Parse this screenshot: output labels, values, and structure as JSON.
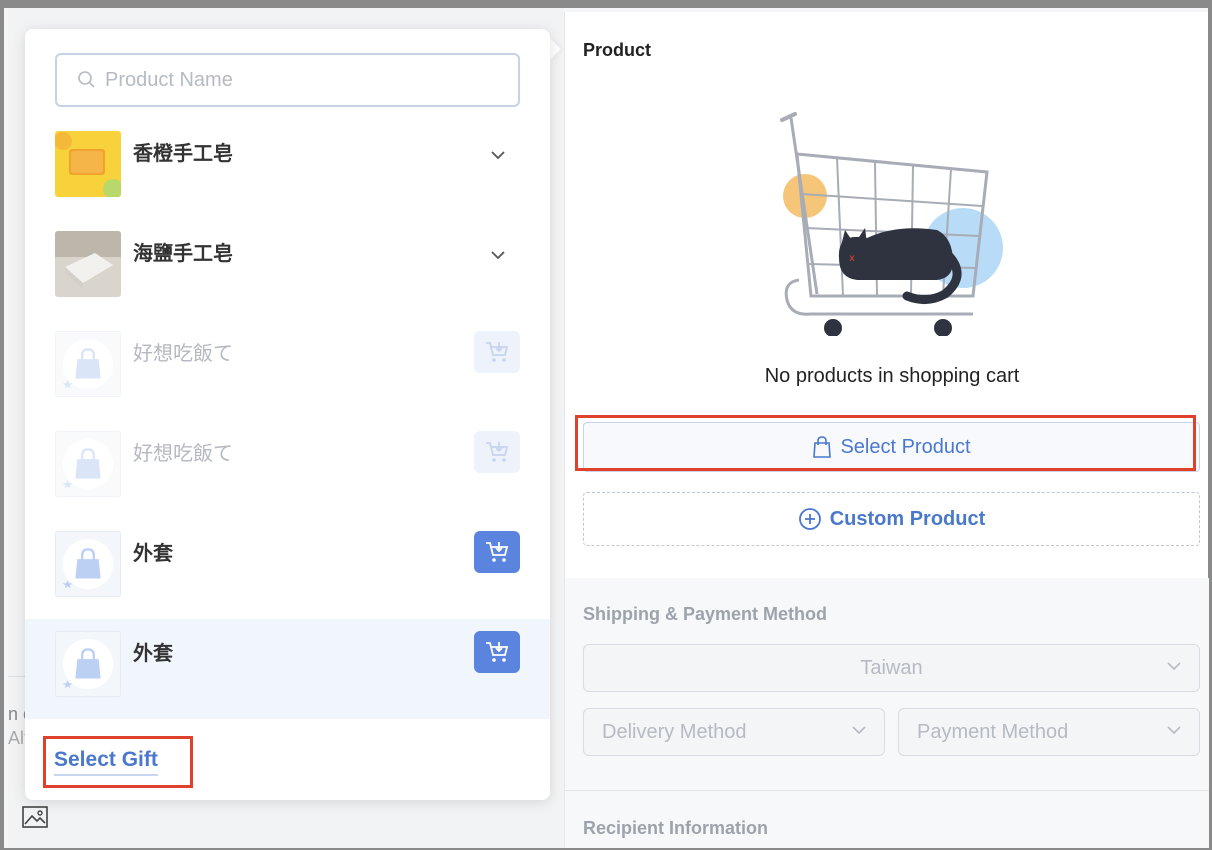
{
  "popup": {
    "search_placeholder": "Product Name",
    "items": [
      {
        "name": "香橙手工皂",
        "state": "expand"
      },
      {
        "name": "海鹽手工皂",
        "state": "expand"
      },
      {
        "name": "好想吃飯て",
        "state": "disabled"
      },
      {
        "name": "好想吃飯て",
        "state": "disabled"
      },
      {
        "name": "外套",
        "state": "active"
      },
      {
        "name": "外套",
        "state": "active"
      }
    ],
    "gift_label": "Select Gift"
  },
  "background": {
    "peek_line1": "n c",
    "peek_line2": "Alt"
  },
  "product": {
    "title": "Product",
    "empty_text": "No products in shopping cart",
    "select_label": "Select Product",
    "custom_label": "Custom Product"
  },
  "shipping": {
    "title": "Shipping & Payment Method",
    "country": "Taiwan",
    "delivery_placeholder": "Delivery Method",
    "payment_placeholder": "Payment Method"
  },
  "recipient": {
    "title": "Recipient Information"
  },
  "colors": {
    "accent": "#4a78cc",
    "button_blue": "#5b84de",
    "highlight_red": "#e0412c"
  }
}
